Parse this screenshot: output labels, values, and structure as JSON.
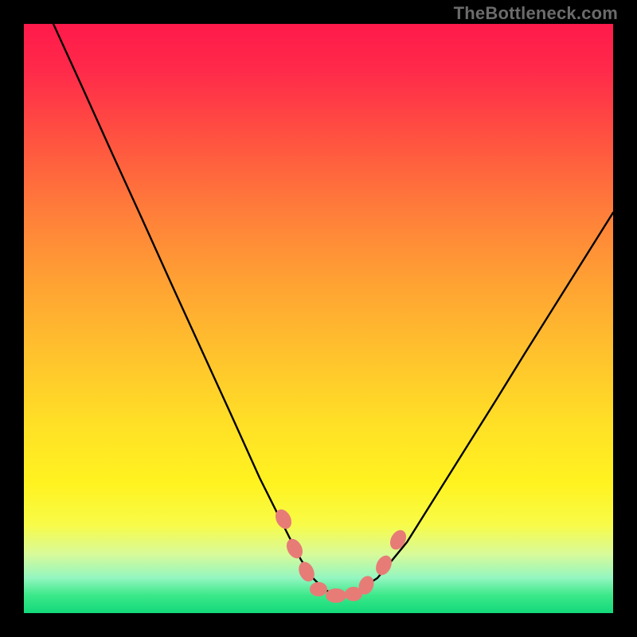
{
  "watermark": "TheBottleneck.com",
  "chart_data": {
    "type": "line",
    "title": "",
    "xlabel": "",
    "ylabel": "",
    "xlim": [
      0,
      100
    ],
    "ylim": [
      0,
      100
    ],
    "series": [
      {
        "name": "bottleneck-curve",
        "x": [
          5,
          10,
          15,
          20,
          25,
          30,
          35,
          40,
          45,
          47,
          49,
          51,
          53,
          55,
          57,
          60,
          65,
          70,
          75,
          80,
          85,
          90,
          95,
          100
        ],
        "y": [
          100,
          89,
          78,
          67,
          56,
          45,
          34,
          23,
          13,
          9,
          6,
          4,
          3,
          3,
          4,
          6,
          12,
          20,
          28,
          36,
          44,
          52,
          60,
          68
        ]
      }
    ],
    "markers": [
      {
        "x": 44,
        "y": 16,
        "name": "left-upper-marker"
      },
      {
        "x": 46,
        "y": 11,
        "name": "left-mid-marker"
      },
      {
        "x": 48,
        "y": 7,
        "name": "left-lower-marker"
      },
      {
        "x": 50,
        "y": 4,
        "name": "bottom-left-marker"
      },
      {
        "x": 52,
        "y": 3,
        "name": "bottom-mid-marker"
      },
      {
        "x": 54,
        "y": 3,
        "name": "bottom-right-marker"
      },
      {
        "x": 56,
        "y": 4,
        "name": "right-lower-marker"
      },
      {
        "x": 59,
        "y": 8,
        "name": "right-mid-marker"
      },
      {
        "x": 62,
        "y": 13,
        "name": "right-upper-marker"
      }
    ],
    "gradient_stops": [
      {
        "pos": 0,
        "color": "#ff1a4b"
      },
      {
        "pos": 20,
        "color": "#ff5440"
      },
      {
        "pos": 44,
        "color": "#ffa233"
      },
      {
        "pos": 68,
        "color": "#ffe026"
      },
      {
        "pos": 85,
        "color": "#f8fb48"
      },
      {
        "pos": 97,
        "color": "#3be889"
      },
      {
        "pos": 100,
        "color": "#12d97a"
      }
    ],
    "marker_color": "#e77c77",
    "curve_color": "#000000"
  }
}
